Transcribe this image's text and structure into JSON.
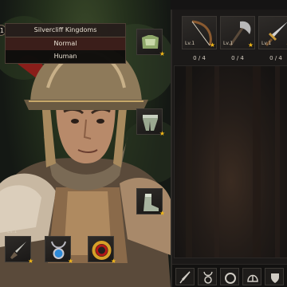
{
  "character": {
    "level": "1",
    "kingdom": "Silvercliff Kingdoms",
    "rank": "Normal",
    "race": "Human"
  },
  "equipment": {
    "slots": [
      {
        "name": "armor-slot",
        "icon": "chest-armor-icon",
        "starred": true
      },
      {
        "name": "legs-slot",
        "icon": "leg-armor-icon",
        "starred": true
      },
      {
        "name": "boots-slot",
        "icon": "boots-icon",
        "starred": true
      },
      {
        "name": "dagger-slot",
        "icon": "dagger-icon",
        "level": "Lv.1",
        "starred": true
      },
      {
        "name": "amulet-slot",
        "icon": "amulet-icon",
        "starred": true
      },
      {
        "name": "ring-slot",
        "icon": "ring-icon",
        "starred": true
      }
    ],
    "star_glyph": "★"
  },
  "weapons": [
    {
      "icon": "bow-icon",
      "level": "Lv.1",
      "count": "0 / 4"
    },
    {
      "icon": "axe-icon",
      "level": "Lv.1",
      "count": "0 / 4"
    },
    {
      "icon": "sword-icon",
      "level": "Lv.1",
      "count": "0 / 4"
    }
  ],
  "filters": [
    {
      "icon": "dagger-filter-icon"
    },
    {
      "icon": "amulet-filter-icon"
    },
    {
      "icon": "ring-filter-icon"
    },
    {
      "icon": "helmet-filter-icon"
    },
    {
      "icon": "shield-filter-icon"
    }
  ],
  "colors": {
    "star": "#f2b818",
    "rank_bg": "#3b1e1a",
    "panel_bg": "#1b1918"
  }
}
